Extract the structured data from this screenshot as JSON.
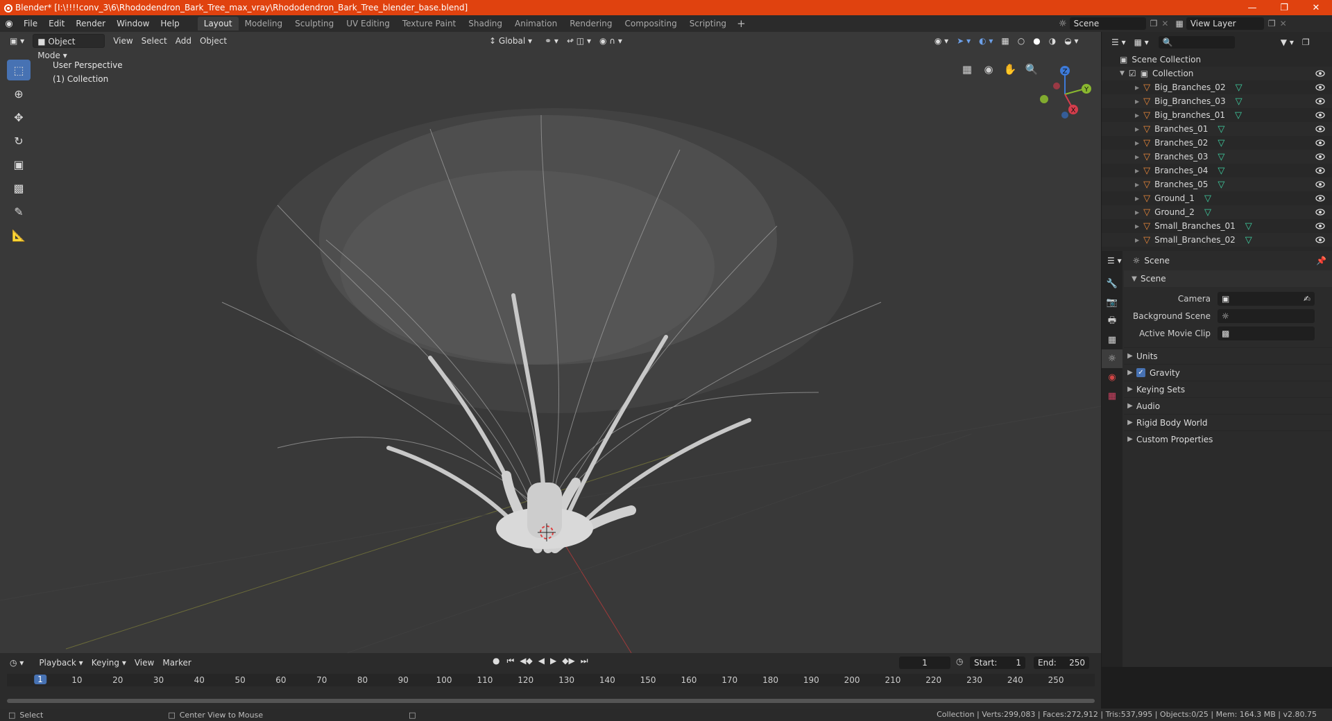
{
  "window": {
    "title": "Blender* [I:\\!!!!conv_3\\6\\Rhododendron_Bark_Tree_max_vray\\Rhododendron_Bark_Tree_blender_base.blend]"
  },
  "menus": [
    "File",
    "Edit",
    "Render",
    "Window",
    "Help"
  ],
  "workspaces": [
    "Layout",
    "Modeling",
    "Sculpting",
    "UV Editing",
    "Texture Paint",
    "Shading",
    "Animation",
    "Rendering",
    "Compositing",
    "Scripting"
  ],
  "active_workspace": "Layout",
  "scene_name": "Scene",
  "view_layer": "View Layer",
  "viewport": {
    "mode": "Object Mode",
    "menu": [
      "View",
      "Select",
      "Add",
      "Object"
    ],
    "orientation": "Global",
    "perspective_label": "User Perspective",
    "collection_label": "(1) Collection",
    "gizmo_axes": [
      "Z",
      "Y",
      "X"
    ]
  },
  "outliner": {
    "root": "Scene Collection",
    "collection": "Collection",
    "items": [
      "Big_Branches_02",
      "Big_Branches_03",
      "Big_branches_01",
      "Branches_01",
      "Branches_02",
      "Branches_03",
      "Branches_04",
      "Branches_05",
      "Ground_1",
      "Ground_2",
      "Small_Branches_01",
      "Small_Branches_02"
    ]
  },
  "properties": {
    "context": "Scene",
    "panel": "Scene",
    "fields": [
      {
        "label": "Camera"
      },
      {
        "label": "Background Scene"
      },
      {
        "label": "Active Movie Clip"
      }
    ],
    "sub_panels": [
      "Units",
      "Gravity",
      "Keying Sets",
      "Audio",
      "Rigid Body World",
      "Custom Properties"
    ],
    "gravity_checked": true
  },
  "timeline": {
    "menu": [
      "Playback",
      "Keying",
      "View",
      "Marker"
    ],
    "current_frame": "1",
    "start_label": "Start:",
    "start": "1",
    "end_label": "End:",
    "end": "250",
    "ruler_numbers": [
      "1",
      "10",
      "20",
      "30",
      "40",
      "50",
      "60",
      "70",
      "80",
      "90",
      "100",
      "110",
      "120",
      "130",
      "140",
      "150",
      "160",
      "170",
      "180",
      "190",
      "200",
      "210",
      "220",
      "230",
      "240",
      "250"
    ]
  },
  "status": {
    "left": "Select",
    "middle": "Center View to Mouse",
    "stats": "Collection | Verts:299,083 | Faces:272,912 | Tris:537,995 | Objects:0/25 | Mem: 164.3 MB | v2.80.75"
  },
  "colors": {
    "title_bar": "#e0420f",
    "accent": "#4772b3",
    "object_icon": "#e8873a",
    "mesh_icon": "#3fd0a2"
  }
}
